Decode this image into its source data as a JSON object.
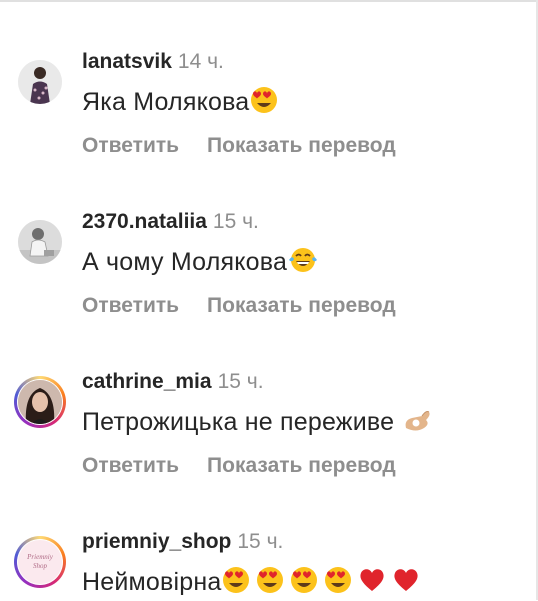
{
  "comments": [
    {
      "username": "lanatsvik",
      "time": "14 ч.",
      "text": "Яка Молякова",
      "emojis": [
        "heart-eyes-emoji"
      ],
      "reply_label": "Ответить",
      "translate_label": "Показать перевод"
    },
    {
      "username": "2370.nataliia",
      "time": "15 ч.",
      "text": "А чому Молякова",
      "emojis": [
        "tears-of-joy-emoji"
      ],
      "reply_label": "Ответить",
      "translate_label": "Показать перевод"
    },
    {
      "username": "cathrine_mia",
      "time": "15 ч.",
      "text": "Петрожицька не переживе",
      "emojis": [
        "ok-hand-emoji"
      ],
      "reply_label": "Ответить",
      "translate_label": "Показать перевод"
    },
    {
      "username": "priemniy_shop",
      "time": "15 ч.",
      "text": "Неймовірна",
      "emojis": [
        "heart-eyes-emoji",
        "heart-eyes-emoji",
        "heart-eyes-emoji",
        "heart-eyes-emoji",
        "red-heart-emoji",
        "red-heart-emoji"
      ],
      "avatar_text": "Priemniy Shop"
    }
  ],
  "colors": {
    "username": "#262626",
    "meta": "#8e8e8e",
    "emoji_yellow": "#fcc21b",
    "heart_red": "#e0242c"
  }
}
